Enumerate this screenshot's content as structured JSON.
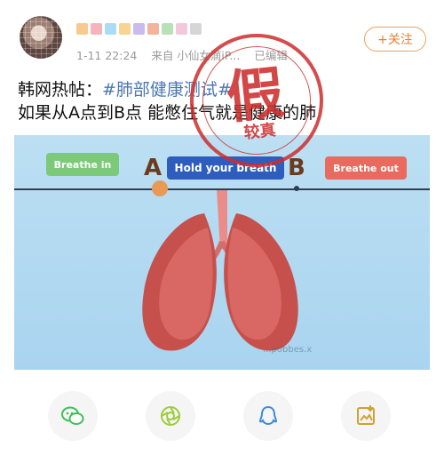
{
  "post": {
    "timestamp": "1-11 22:24",
    "source_prefix": "来自",
    "source_name": "小仙女滴iP...",
    "edited": "已编辑",
    "follow_label": "+关注",
    "line1_prefix": "韩网热帖：",
    "line1_hashtag": "#肺部健康测试#",
    "line2": "如果从A点到B点 能憋住气就是健康的肺"
  },
  "stamp": {
    "main": "假",
    "sub": "较真"
  },
  "image": {
    "label_breathe_in": "Breathe in",
    "label_hold": "Hold your breath",
    "label_breathe_out": "Breathe out",
    "point_a": "A",
    "point_b": "B",
    "watermark": "...pobbes.x"
  },
  "colors": {
    "follow_orange": "#f07f2a",
    "hashtag_blue": "#4a77b3",
    "stamp_red": "#cd2d2d",
    "icon_green": "#3fbf5a",
    "icon_lime": "#9ccc3a",
    "icon_blue": "#3c8ae0",
    "icon_gold": "#d4a033"
  },
  "actions": [
    {
      "icon": "wechat-icon"
    },
    {
      "icon": "moments-icon"
    },
    {
      "icon": "qq-icon"
    },
    {
      "icon": "image-save-icon"
    }
  ]
}
